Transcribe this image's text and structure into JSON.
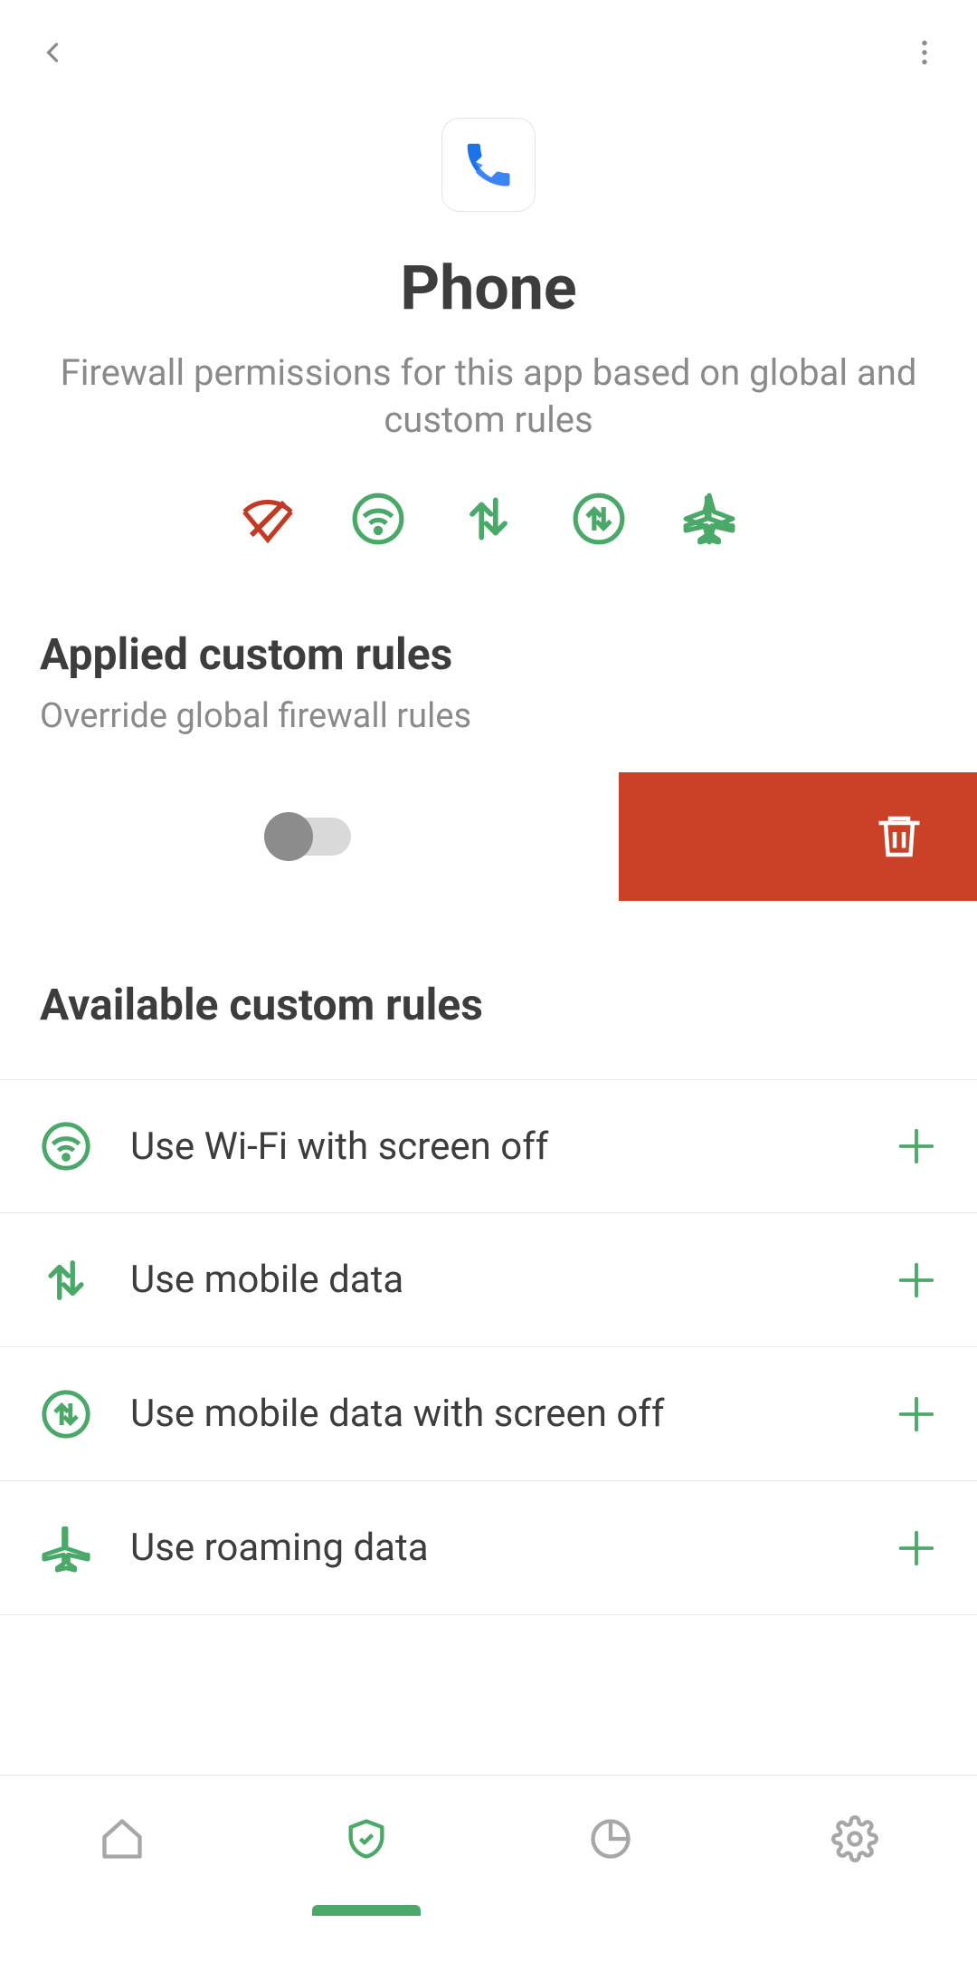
{
  "app": {
    "name": "Phone",
    "subtitle": "Firewall permissions for this app based on global and custom rules"
  },
  "colors": {
    "green": "#4aa968",
    "red": "#cb4127",
    "orangered": "#c13a23",
    "gray": "#a7a7a7",
    "text": "#3d3d3d"
  },
  "status_icons": [
    {
      "name": "wifi-blocked",
      "color": "#c13a23"
    },
    {
      "name": "wifi-screenoff",
      "color": "#4aa968"
    },
    {
      "name": "mobile-data",
      "color": "#4aa968"
    },
    {
      "name": "mobile-data-screenoff",
      "color": "#4aa968"
    },
    {
      "name": "roaming",
      "color": "#4aa968"
    }
  ],
  "sections": {
    "applied": {
      "title": "Applied custom rules",
      "subtitle": "Override global firewall rules",
      "toggle_state": "off"
    },
    "available": {
      "title": "Available custom rules"
    }
  },
  "available_rules": [
    {
      "icon": "wifi-screenoff",
      "label": "Use Wi-Fi with screen off"
    },
    {
      "icon": "mobile-data",
      "label": "Use mobile data"
    },
    {
      "icon": "mobile-data-screenoff",
      "label": "Use mobile data with screen off"
    },
    {
      "icon": "roaming",
      "label": "Use roaming data"
    }
  ],
  "bottom_nav": {
    "items": [
      "home",
      "firewall",
      "stats",
      "settings"
    ],
    "active_index": 1
  }
}
